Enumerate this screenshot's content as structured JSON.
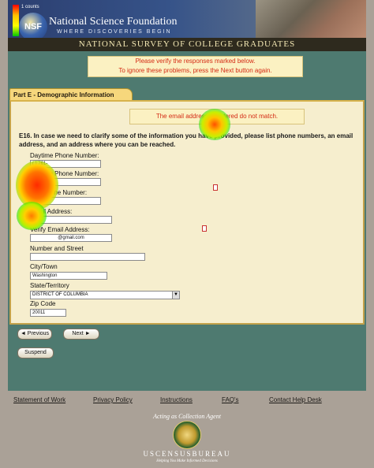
{
  "heatmap_legend": {
    "label": "1 counts"
  },
  "header": {
    "logo_text": "NSF",
    "org_name": "National Science Foundation",
    "org_tagline": "WHERE DISCOVERIES BEGIN",
    "survey_title": "NATIONAL SURVEY OF COLLEGE GRADUATES"
  },
  "alert": {
    "line1": "Please verify the responses marked below.",
    "line2": "To ignore these problems, press the Next button again."
  },
  "section": {
    "title": "Part E - Demographic Information"
  },
  "form": {
    "error_message": "The email addresses entered do not match.",
    "question": "E16. In case we need to clarify some of the information you have provided, please list phone numbers, an email address, and an address where you can be reached.",
    "fields": {
      "daytime_phone": {
        "label": "Daytime Phone Number:",
        "value": "(  ) 761-"
      },
      "evening_phone": {
        "label": "Evening Phone Number:",
        "value": ""
      },
      "cell_phone": {
        "label": "Cell Phone Number:",
        "value": ""
      },
      "email": {
        "label": "Email Address:",
        "value": ""
      },
      "verify_email": {
        "label": "Verify Email Address:",
        "value": "@gmail.com"
      },
      "street": {
        "label": "Number and Street",
        "value": ""
      },
      "city": {
        "label": "City/Town",
        "value": "Washington"
      },
      "state": {
        "label": "State/Territory",
        "value": "DISTRICT OF COLUMBIA"
      },
      "zip": {
        "label": "Zip Code",
        "value": "20011"
      }
    }
  },
  "buttons": {
    "previous": "◄ Previous",
    "next": "Next ►",
    "suspend": "Suspend"
  },
  "footer": {
    "links": [
      "Statement of Work",
      "Privacy Policy",
      "Instructions",
      "FAQ's",
      "Contact Help Desk"
    ],
    "agent_label": "Acting as Collection Agent",
    "bureau_name": "USCENSUSBUREAU",
    "bureau_tagline": "Helping You Make Informed Decisions"
  }
}
